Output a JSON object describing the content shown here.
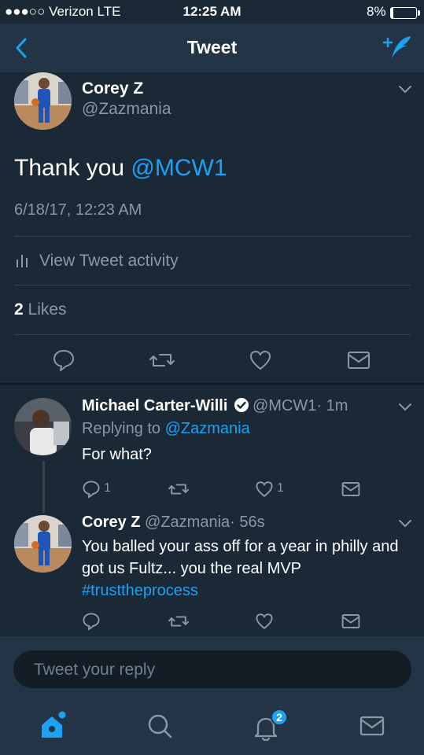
{
  "status_bar": {
    "carrier": "●●●○○ Verizon  LTE",
    "time": "12:25 AM",
    "battery": "8%"
  },
  "nav": {
    "title": "Tweet",
    "back_icon": "chevron-left-icon",
    "compose_icon": "compose-tweet-icon"
  },
  "main_tweet": {
    "name": "Corey Z",
    "handle": "@Zazmania",
    "text_prefix": "Thank you ",
    "mention": "@MCW1",
    "timestamp": "6/18/17, 12:23 AM",
    "activity_label": "View Tweet activity",
    "likes_count": "2",
    "likes_label": " Likes"
  },
  "replies": [
    {
      "name": "Michael Carter-Willi",
      "handle": "@MCW1",
      "time": "· 1m",
      "replying_prefix": "Replying to ",
      "replying_to": "@Zazmania",
      "text": "For what?",
      "reply_count": "1",
      "like_count": "1"
    },
    {
      "name": "Corey Z",
      "handle": "@Zazmania",
      "time": "· 56s",
      "text": "You balled your ass off for a year in philly and got us Fultz... you the real MVP ",
      "hashtag": "#trusttheprocess"
    }
  ],
  "reply_box": {
    "placeholder": "Tweet your reply"
  },
  "tabbar": {
    "notifications_badge": "2"
  },
  "colors": {
    "accent": "#1da1f2",
    "background": "#1b2836",
    "bar": "#243447",
    "muted": "#8899a6"
  }
}
